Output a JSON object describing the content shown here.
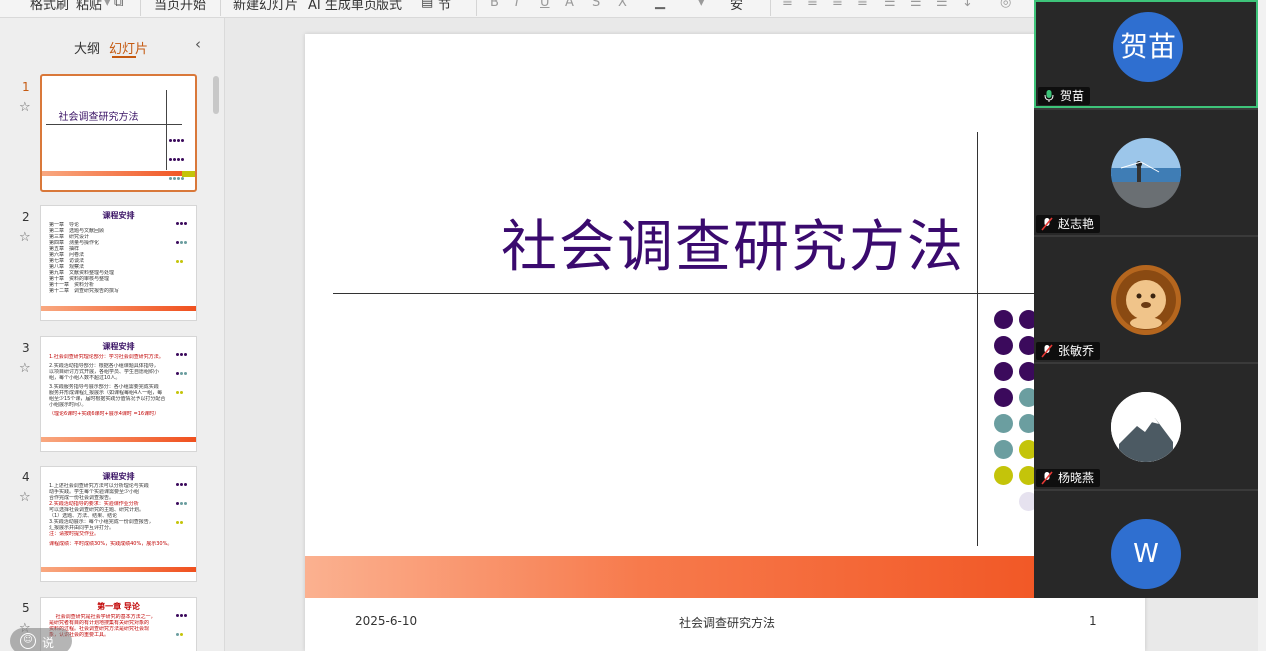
{
  "toolbar": {
    "items": [
      "格式刷",
      "粘贴",
      "当页开始",
      "新建幻灯片",
      "AI 生成单页",
      "版式",
      "节"
    ],
    "font_size": "安"
  },
  "left_panel": {
    "tab_outline": "大纲",
    "tab_slides": "幻灯片",
    "thumbs": [
      {
        "num": "1",
        "title": "社会调查研究方法"
      },
      {
        "num": "2",
        "title": "课程安排",
        "lines": [
          "第一章　导论",
          "第二章　选题与文献回顾",
          "第三章　研究设计",
          "第四章　测量与操作化",
          "第五章　抽样",
          "第六章　问卷法",
          "第七章　访谈法",
          "第八章　观察法",
          "第九章　文献资料整理与处理",
          "第十章　资料的审核与整理",
          "第十一章　资料分析",
          "第十二章　调查研究报告的撰写"
        ]
      },
      {
        "num": "3",
        "title": "课程安排",
        "lines": [
          "1.社会调查研究理论部分：学习社会调查研究方法。",
          "2.实践活动指导部分：根据各小组课题具体指导，",
          "以项目研讨方式开展，各组学员、学生自愿组织小",
          "组，每个小组人数不超过10人。",
          "3.实践服务指导与展示部分：各小组需要完成实践",
          "服务并形成课程汇报展示（如课程每组4人一组，每",
          "组至少15个课，届时根据实践分值情况予以打分配合",
          "小组展示时间）。",
          "（理论6课时+实践6课时+展示4课时 =16课时）"
        ]
      },
      {
        "num": "4",
        "title": "课程安排",
        "lines": [
          "1.上述社会调查研究方法可以分析理论与实践",
          "动手实践。学生每个实验课需要至少小组",
          "合作完成一份社会调查报告。",
          "2.实践活动指导的要求：实验课作业分析",
          "可以选择社会调查研究的主题、研究计划。",
          "（1）选题、方法、结果、结论",
          "3.实践活动展示：每个小组完成一份调查报告，",
          "汇报展示并由同学互评打分。",
          "注：请按时提交作业。",
          "课程成绩：平时成绩30%，实践成绩40%，展示30%。"
        ]
      },
      {
        "num": "5",
        "title": "第一章  导论",
        "lines": [
          "　 社会调查研究是社会学研究的基本方法之一，",
          "是研究者有目的有计划地搜集有关研究对象的",
          "资料的过程。社会调查研究方法是研究社会现",
          "象，认识社会的重要工具。"
        ]
      }
    ]
  },
  "speak": {
    "label": "说"
  },
  "slide": {
    "title": "社会调查研究方法",
    "footer_date": "2025-6-10",
    "footer_title": "社会调查研究方法",
    "footer_page": "1"
  },
  "participants": [
    {
      "name": "贺苗",
      "avatar_text": "贺苗",
      "muted": false
    },
    {
      "name": "赵志艳",
      "avatar_text": "",
      "muted": true
    },
    {
      "name": "张敏乔",
      "avatar_text": "",
      "muted": true
    },
    {
      "name": "杨晓燕",
      "avatar_text": "",
      "muted": true
    },
    {
      "name": "W",
      "avatar_text": "W",
      "muted": true
    }
  ],
  "colors": {
    "accent": "#c55a11",
    "slide_title": "#3a0a6e",
    "dot_purple": "#3b0a5c",
    "dot_teal": "#6b9ea0",
    "dot_olive": "#c4c40a",
    "dot_lilac": "#e6e2ef",
    "bar_orange": "#f04f1c",
    "avatar_blue": "#2f6fd0",
    "active_speaker": "#3ec47a"
  }
}
